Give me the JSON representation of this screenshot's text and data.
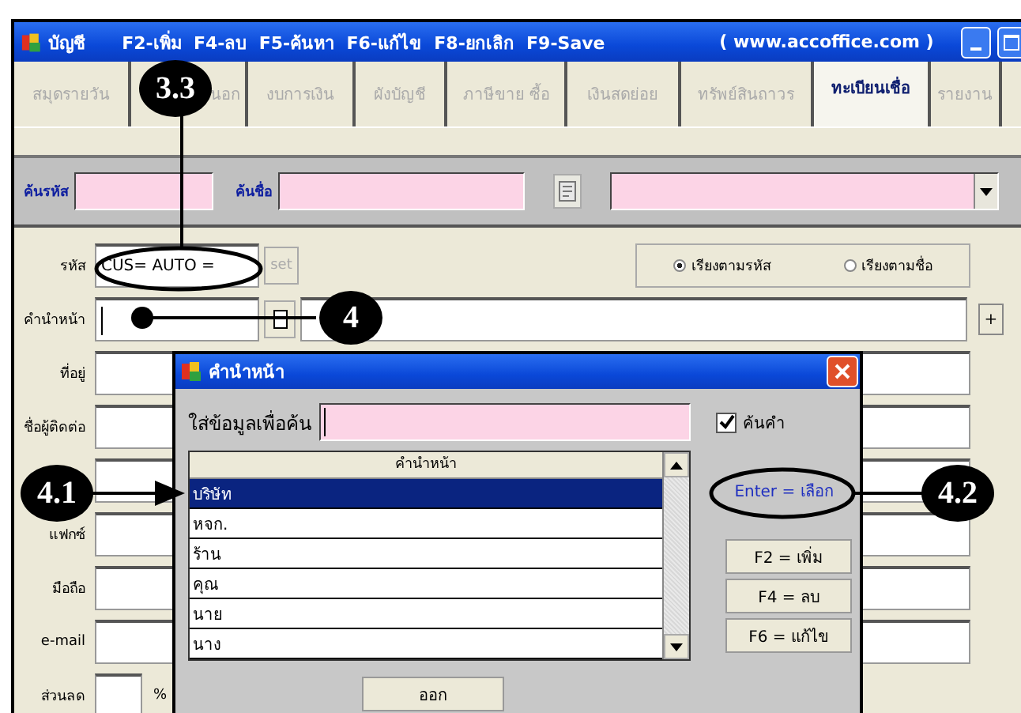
{
  "window": {
    "title": "บัญชี",
    "shortcuts": "F2-เพิ่ม  F4-ลบ  F5-ค้นหา  F6-แก้ไข  F8-ยกเลิก  F9-Save",
    "website": "( www.accoffice.com )"
  },
  "tabs": [
    {
      "label": "สมุดรายวัน",
      "selected": false
    },
    {
      "label": "นอก",
      "selected": false
    },
    {
      "label": "งบการเงิน",
      "selected": false
    },
    {
      "label": "ผังบัญชี",
      "selected": false
    },
    {
      "label": "ภาษีขาย ซื้อ",
      "selected": false
    },
    {
      "label": "เงินสดย่อย",
      "selected": false
    },
    {
      "label": "ทรัพย์สินถาวร",
      "selected": false
    },
    {
      "label": "ทะเบียนเชื่อ",
      "selected": true
    },
    {
      "label": "รายงาน",
      "selected": false
    }
  ],
  "search_bar": {
    "code_label": "ค้นรหัส",
    "name_label": "ค้นชื่อ"
  },
  "form": {
    "code": {
      "label": "รหัส",
      "value": "CUS= AUTO =",
      "set_button": "set",
      "set_disabled": true
    },
    "sort_options": [
      {
        "label": "เรียงตามรหัส",
        "selected": true
      },
      {
        "label": "เรียงตามชื่อ",
        "selected": false
      }
    ],
    "prefix_label": "คำนำหน้า",
    "plus_button": "+",
    "fields": [
      {
        "label": "ที่อยู่"
      },
      {
        "label": "ชื่อผู้ติดต่อ"
      },
      {
        "label": "แฟกซ์"
      },
      {
        "label": "มือถือ"
      },
      {
        "label": "e-mail"
      }
    ],
    "discount": {
      "label": "ส่วนลด",
      "unit": "%"
    }
  },
  "dialog": {
    "title": "คำนำหน้า",
    "search_label": "ใส่ข้อมูลเพื่อค้น",
    "match_checkbox": {
      "label": "ค้นคำ",
      "checked": true
    },
    "list_header": "คำนำหน้า",
    "rows": [
      {
        "text": "บริษัท",
        "selected": true
      },
      {
        "text": "หจก.",
        "selected": false
      },
      {
        "text": "ร้าน",
        "selected": false
      },
      {
        "text": "คุณ",
        "selected": false
      },
      {
        "text": "นาย",
        "selected": false
      },
      {
        "text": "นาง",
        "selected": false
      }
    ],
    "select_button": "Enter = เลือก",
    "buttons": [
      "F2 = เพิ่ม",
      "F4 = ลบ",
      "F6 = แก้ไข"
    ],
    "exit_button": "ออก"
  },
  "callouts": [
    {
      "label": "3.3"
    },
    {
      "label": "4"
    },
    {
      "label": "4.1"
    },
    {
      "label": "4.2"
    }
  ]
}
